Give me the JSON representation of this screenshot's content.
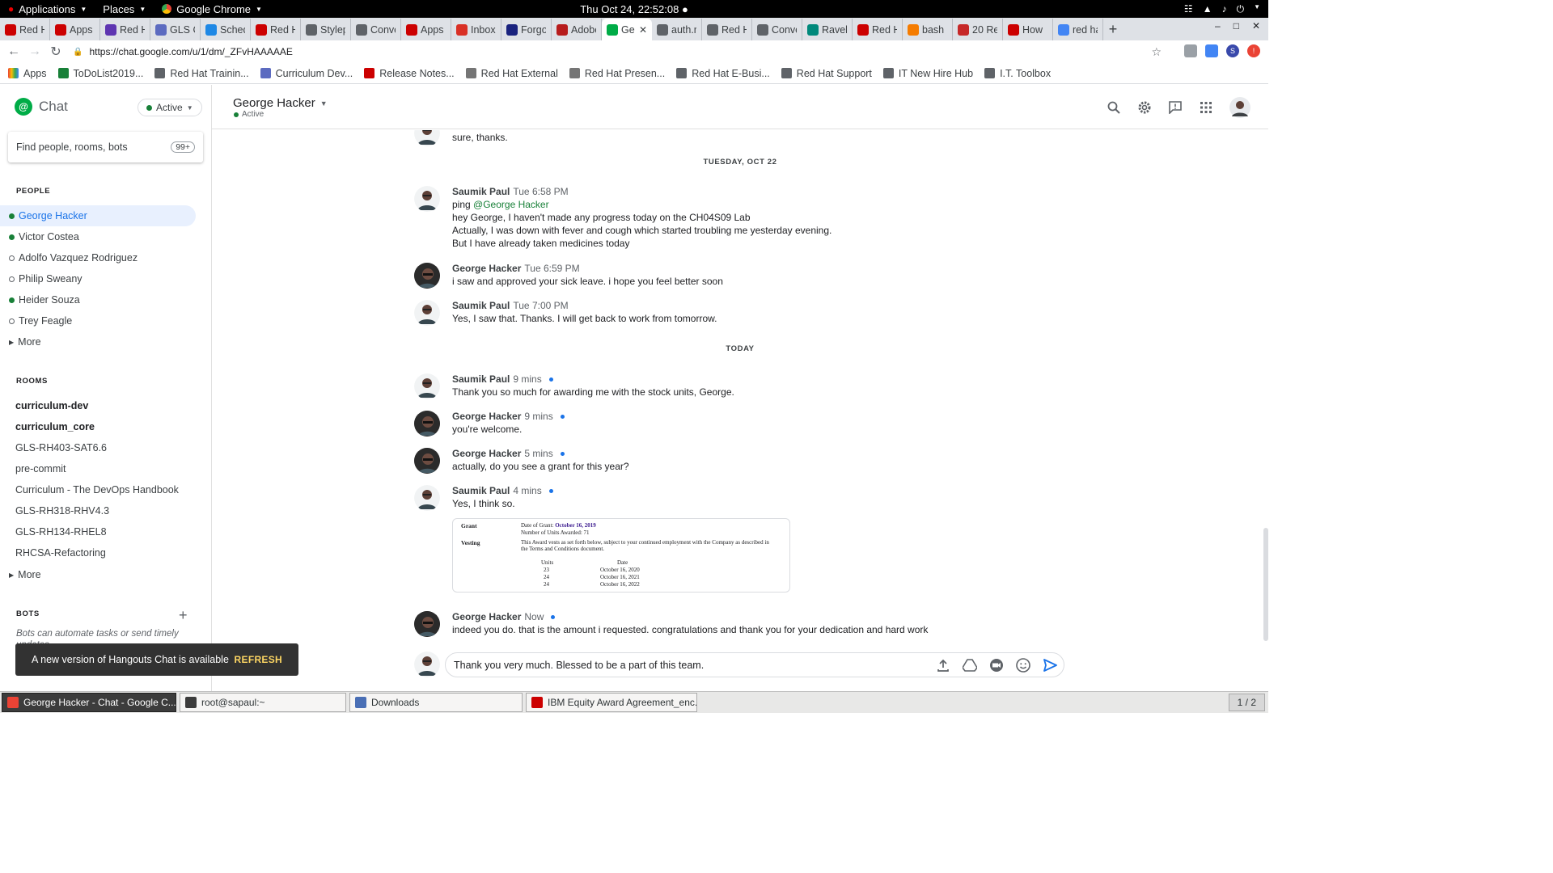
{
  "topbar": {
    "applications": "Applications",
    "places": "Places",
    "chrome": "Google Chrome",
    "clock": "Thu Oct 24, 22:52:08 ●"
  },
  "tabs": [
    {
      "label": "Red H",
      "color": "#cc0000"
    },
    {
      "label": "Apps",
      "color": "#cc0000"
    },
    {
      "label": "Red H",
      "color": "#5e35b1"
    },
    {
      "label": "GLS C",
      "color": "#5c6bc0"
    },
    {
      "label": "Sched",
      "color": "#1e88e5"
    },
    {
      "label": "Red H",
      "color": "#cc0000"
    },
    {
      "label": "Stylep",
      "color": "#5f6368"
    },
    {
      "label": "Conve",
      "color": "#5f6368"
    },
    {
      "label": "Apps",
      "color": "#cc0000"
    },
    {
      "label": "Inbox",
      "color": "#d93025"
    },
    {
      "label": "Forgo",
      "color": "#1a237e"
    },
    {
      "label": "Adobe",
      "color": "#b71c1c"
    },
    {
      "label": "Ge",
      "color": "#00ac47",
      "active": true
    },
    {
      "label": "auth.r",
      "color": "#5f6368"
    },
    {
      "label": "Red H",
      "color": "#5f6368"
    },
    {
      "label": "Conve",
      "color": "#5f6368"
    },
    {
      "label": "Ravell",
      "color": "#00897b"
    },
    {
      "label": "Red H",
      "color": "#cc0000"
    },
    {
      "label": "bash",
      "color": "#f57c00"
    },
    {
      "label": "20 Re",
      "color": "#c62828"
    },
    {
      "label": "How",
      "color": "#cc0000"
    },
    {
      "label": "red ha",
      "color": "#4285f4"
    }
  ],
  "url": "https://chat.google.com/u/1/dm/_ZFvHAAAAAE",
  "bookmarks": [
    {
      "label": "Apps",
      "color": "#4285f4"
    },
    {
      "label": "ToDoList2019...",
      "color": "#188038"
    },
    {
      "label": "Red Hat Trainin...",
      "color": "#5f6368"
    },
    {
      "label": "Curriculum Dev...",
      "color": "#5c6bc0"
    },
    {
      "label": "Release Notes...",
      "color": "#cc0000"
    },
    {
      "label": "Red Hat External",
      "color": "#757575"
    },
    {
      "label": "Red Hat Presen...",
      "color": "#757575"
    },
    {
      "label": "Red Hat E-Busi...",
      "color": "#5f6368"
    },
    {
      "label": "Red Hat Support",
      "color": "#5f6368"
    },
    {
      "label": "IT New Hire Hub",
      "color": "#5f6368"
    },
    {
      "label": "I.T. Toolbox",
      "color": "#5f6368"
    }
  ],
  "sidebar": {
    "app_name": "Chat",
    "status": "Active",
    "search_placeholder": "Find people, rooms, bots",
    "search_badge": "99+",
    "people_heading": "PEOPLE",
    "people": [
      {
        "name": "George Hacker",
        "online": true,
        "active": true
      },
      {
        "name": "Victor Costea",
        "online": true
      },
      {
        "name": "Adolfo Vazquez Rodriguez",
        "online": false
      },
      {
        "name": "Philip Sweany",
        "online": false
      },
      {
        "name": "Heider Souza",
        "online": true
      },
      {
        "name": "Trey Feagle",
        "online": false
      }
    ],
    "more": "More",
    "rooms_heading": "ROOMS",
    "rooms": [
      {
        "name": "curriculum-dev",
        "bold": true
      },
      {
        "name": "curriculum_core",
        "bold": true
      },
      {
        "name": "GLS-RH403-SAT6.6"
      },
      {
        "name": "pre-commit"
      },
      {
        "name": "Curriculum - The DevOps Handbook"
      },
      {
        "name": "GLS-RH318-RHV4.3"
      },
      {
        "name": "GLS-RH134-RHEL8"
      },
      {
        "name": "RHCSA-Refactoring"
      }
    ],
    "bots_heading": "BOTS",
    "bots_desc": "Bots can automate tasks or send timely updates."
  },
  "toast": {
    "message": "A new version of Hangouts Chat is available",
    "action": "REFRESH"
  },
  "conversation": {
    "title": "George Hacker",
    "status": "Active"
  },
  "thread": {
    "partial_top": "sure, thanks.",
    "day1": "TUESDAY, OCT 22",
    "day2": "TODAY",
    "messages": [
      {
        "sender": "Saumik Paul",
        "time": "Tue 6:58 PM",
        "lines": [
          "ping",
          "hey George, I haven't made any progress today on the CH04S09 Lab",
          "Actually, I was down with fever and cough which started troubling me yesterday evening.",
          "But I have already taken medicines today"
        ],
        "mention": "@George Hacker"
      },
      {
        "sender": "George Hacker",
        "time": "Tue 6:59 PM",
        "lines": [
          "i saw and approved your sick leave. i hope you feel better soon"
        ]
      },
      {
        "sender": "Saumik Paul",
        "time": "Tue 7:00 PM",
        "lines": [
          "Yes, I saw that. Thanks. I will get back to work from tomorrow."
        ]
      },
      {
        "sender": "Saumik Paul",
        "time": "9 mins",
        "lines": [
          "Thank you so much for awarding me with the stock units, George."
        ]
      },
      {
        "sender": "George Hacker",
        "time": "9 mins",
        "lines": [
          "you're welcome."
        ]
      },
      {
        "sender": "George Hacker",
        "time": "5 mins",
        "lines": [
          "actually, do you see a grant for this year?"
        ]
      },
      {
        "sender": "Saumik Paul",
        "time": "4 mins",
        "lines": [
          "Yes, I think so."
        ]
      },
      {
        "sender": "George Hacker",
        "time": "Now",
        "lines": [
          "indeed you do. that is the amount i requested. congratulations and thank you for your dedication and hard work"
        ]
      }
    ]
  },
  "attachment": {
    "grant_label": "Grant",
    "grant_date_label": "Date of Grant:",
    "grant_date": "October 16, 2019",
    "units_awarded": "Number of Units Awarded:  71",
    "vesting_label": "Vesting",
    "vesting_text_1": "This Award vests as set forth below, subject to your continued employment with the Company as described in",
    "vesting_text_2": "the Terms and Conditions document.",
    "col_units": "Units",
    "col_date": "Date",
    "rows": [
      {
        "units": "23",
        "date": "October 16, 2020"
      },
      {
        "units": "24",
        "date": "October 16, 2021"
      },
      {
        "units": "24",
        "date": "October 16, 2022"
      }
    ]
  },
  "composer": {
    "value": "Thank you very much. Blessed to be a part of this team."
  },
  "taskbar": {
    "items": [
      {
        "label": "George Hacker - Chat - Google C...",
        "active": true
      },
      {
        "label": "root@sapaul:~"
      },
      {
        "label": "Downloads"
      },
      {
        "label": "IBM Equity Award Agreement_enc..."
      }
    ],
    "workspace": "1 / 2"
  }
}
